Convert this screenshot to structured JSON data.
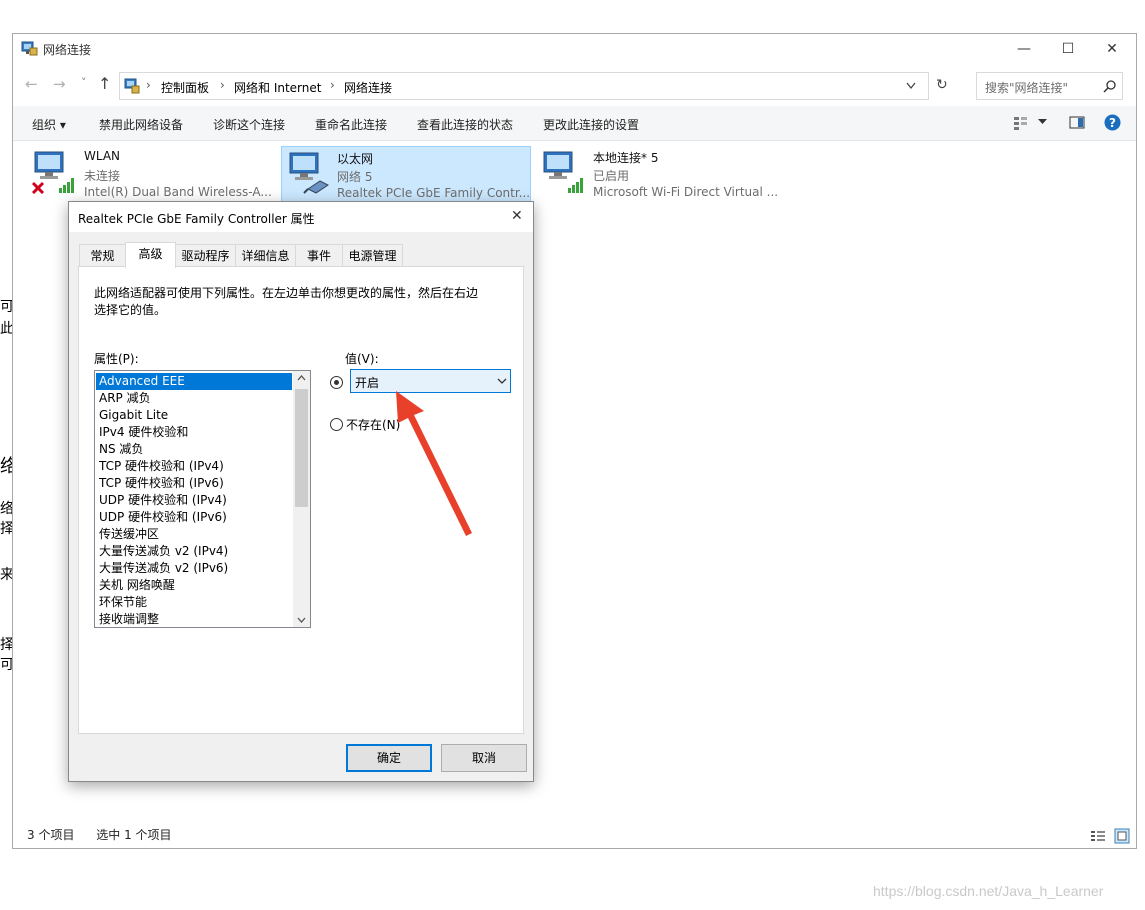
{
  "window": {
    "title": "网络连接",
    "minimize": "—",
    "maximize": "☐",
    "close": "✕"
  },
  "address": {
    "back": "←",
    "forward": "→",
    "recent": "˅",
    "up": "↑",
    "breadcrumbs": [
      "控制面板",
      "网络和 Internet",
      "网络连接"
    ],
    "refresh": "↻",
    "search_placeholder": "搜索\"网络连接\""
  },
  "toolbar": {
    "organize": "组织",
    "disable": "禁用此网络设备",
    "diagnose": "诊断这个连接",
    "rename": "重命名此连接",
    "view_status": "查看此连接的状态",
    "change_settings": "更改此连接的设置"
  },
  "connections": [
    {
      "name": "WLAN",
      "status": "未连接",
      "device": "Intel(R) Dual Band Wireless-A..."
    },
    {
      "name": "以太网",
      "status": "网络 5",
      "device": "Realtek PCIe GbE Family Contr..."
    },
    {
      "name": "本地连接* 5",
      "status": "已启用",
      "device": "Microsoft Wi-Fi Direct Virtual ..."
    }
  ],
  "statusbar": {
    "count": "3 个项目",
    "selected": "选中 1 个项目"
  },
  "left_clip": [
    "可使",
    "此设",
    "络",
    "络",
    "择么",
    "来",
    "择 i",
    "可以"
  ],
  "dialog": {
    "title": "Realtek PCIe GbE Family Controller 属性",
    "close": "✕",
    "tabs": [
      "常规",
      "高级",
      "驱动程序",
      "详细信息",
      "事件",
      "电源管理"
    ],
    "description": "此网络适配器可使用下列属性。在左边单击你想更改的属性，然后在右边选择它的值。",
    "property_label": "属性(P):",
    "value_label": "值(V):",
    "properties": [
      "Advanced EEE",
      "ARP 减负",
      "Gigabit Lite",
      "IPv4 硬件校验和",
      "NS 减负",
      "TCP 硬件校验和 (IPv4)",
      "TCP 硬件校验和 (IPv6)",
      "UDP 硬件校验和 (IPv4)",
      "UDP 硬件校验和 (IPv6)",
      "传送缓冲区",
      "大量传送减负 v2 (IPv4)",
      "大量传送减负 v2 (IPv6)",
      "关机 网络唤醒",
      "环保节能",
      "接收端调整"
    ],
    "selected_value": "开启",
    "not_present": "不存在(N)",
    "ok": "确定",
    "cancel": "取消"
  },
  "watermark": "https://blog.csdn.net/Java_h_Learner",
  "colors": {
    "accent": "#0078d7",
    "arrow": "#e8402a",
    "selection_bg": "#cce8ff"
  }
}
